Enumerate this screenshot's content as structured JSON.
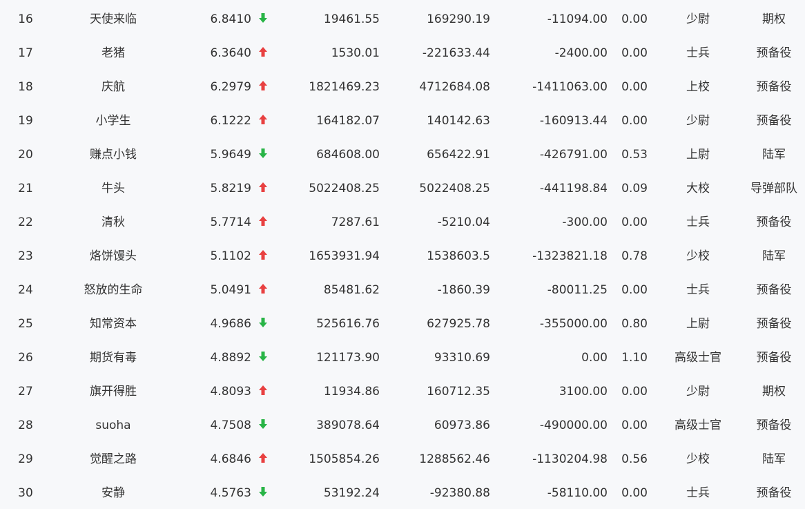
{
  "colors": {
    "up": "#e84040",
    "down": "#28b446",
    "text": "#333333",
    "background": "#f7f8fa"
  },
  "rows": [
    {
      "rank": "16",
      "name": "天使来临",
      "score": "6.8410",
      "trend": "down",
      "v1": "19461.55",
      "v2": "169290.19",
      "v3": "-11094.00",
      "v4": "0.00",
      "level": "少尉",
      "category": "期权"
    },
    {
      "rank": "17",
      "name": "老猪",
      "score": "6.3640",
      "trend": "up",
      "v1": "1530.01",
      "v2": "-221633.44",
      "v3": "-2400.00",
      "v4": "0.00",
      "level": "士兵",
      "category": "预备役"
    },
    {
      "rank": "18",
      "name": "庆航",
      "score": "6.2979",
      "trend": "up",
      "v1": "1821469.23",
      "v2": "4712684.08",
      "v3": "-1411063.00",
      "v4": "0.00",
      "level": "上校",
      "category": "预备役"
    },
    {
      "rank": "19",
      "name": "小学生",
      "score": "6.1222",
      "trend": "up",
      "v1": "164182.07",
      "v2": "140142.63",
      "v3": "-160913.44",
      "v4": "0.00",
      "level": "少尉",
      "category": "预备役"
    },
    {
      "rank": "20",
      "name": "赚点小钱",
      "score": "5.9649",
      "trend": "down",
      "v1": "684608.00",
      "v2": "656422.91",
      "v3": "-426791.00",
      "v4": "0.53",
      "level": "上尉",
      "category": "陆军"
    },
    {
      "rank": "21",
      "name": "牛头",
      "score": "5.8219",
      "trend": "up",
      "v1": "5022408.25",
      "v2": "5022408.25",
      "v3": "-441198.84",
      "v4": "0.09",
      "level": "大校",
      "category": "导弹部队"
    },
    {
      "rank": "22",
      "name": "清秋",
      "score": "5.7714",
      "trend": "up",
      "v1": "7287.61",
      "v2": "-5210.04",
      "v3": "-300.00",
      "v4": "0.00",
      "level": "士兵",
      "category": "预备役"
    },
    {
      "rank": "23",
      "name": "烙饼馒头",
      "score": "5.1102",
      "trend": "up",
      "v1": "1653931.94",
      "v2": "1538603.5",
      "v3": "-1323821.18",
      "v4": "0.78",
      "level": "少校",
      "category": "陆军"
    },
    {
      "rank": "24",
      "name": "怒放的生命",
      "score": "5.0491",
      "trend": "up",
      "v1": "85481.62",
      "v2": "-1860.39",
      "v3": "-80011.25",
      "v4": "0.00",
      "level": "士兵",
      "category": "预备役"
    },
    {
      "rank": "25",
      "name": "知常资本",
      "score": "4.9686",
      "trend": "down",
      "v1": "525616.76",
      "v2": "627925.78",
      "v3": "-355000.00",
      "v4": "0.80",
      "level": "上尉",
      "category": "预备役"
    },
    {
      "rank": "26",
      "name": "期货有毒",
      "score": "4.8892",
      "trend": "down",
      "v1": "121173.90",
      "v2": "93310.69",
      "v3": "0.00",
      "v4": "1.10",
      "level": "高级士官",
      "category": "预备役"
    },
    {
      "rank": "27",
      "name": "旗开得胜",
      "score": "4.8093",
      "trend": "up",
      "v1": "11934.86",
      "v2": "160712.35",
      "v3": "3100.00",
      "v4": "0.00",
      "level": "少尉",
      "category": "期权"
    },
    {
      "rank": "28",
      "name": "suoha",
      "score": "4.7508",
      "trend": "down",
      "v1": "389078.64",
      "v2": "60973.86",
      "v3": "-490000.00",
      "v4": "0.00",
      "level": "高级士官",
      "category": "预备役"
    },
    {
      "rank": "29",
      "name": "觉醒之路",
      "score": "4.6846",
      "trend": "up",
      "v1": "1505854.26",
      "v2": "1288562.46",
      "v3": "-1130204.98",
      "v4": "0.56",
      "level": "少校",
      "category": "陆军"
    },
    {
      "rank": "30",
      "name": "安静",
      "score": "4.5763",
      "trend": "down",
      "v1": "53192.24",
      "v2": "-92380.88",
      "v3": "-58110.00",
      "v4": "0.00",
      "level": "士兵",
      "category": "预备役"
    }
  ]
}
